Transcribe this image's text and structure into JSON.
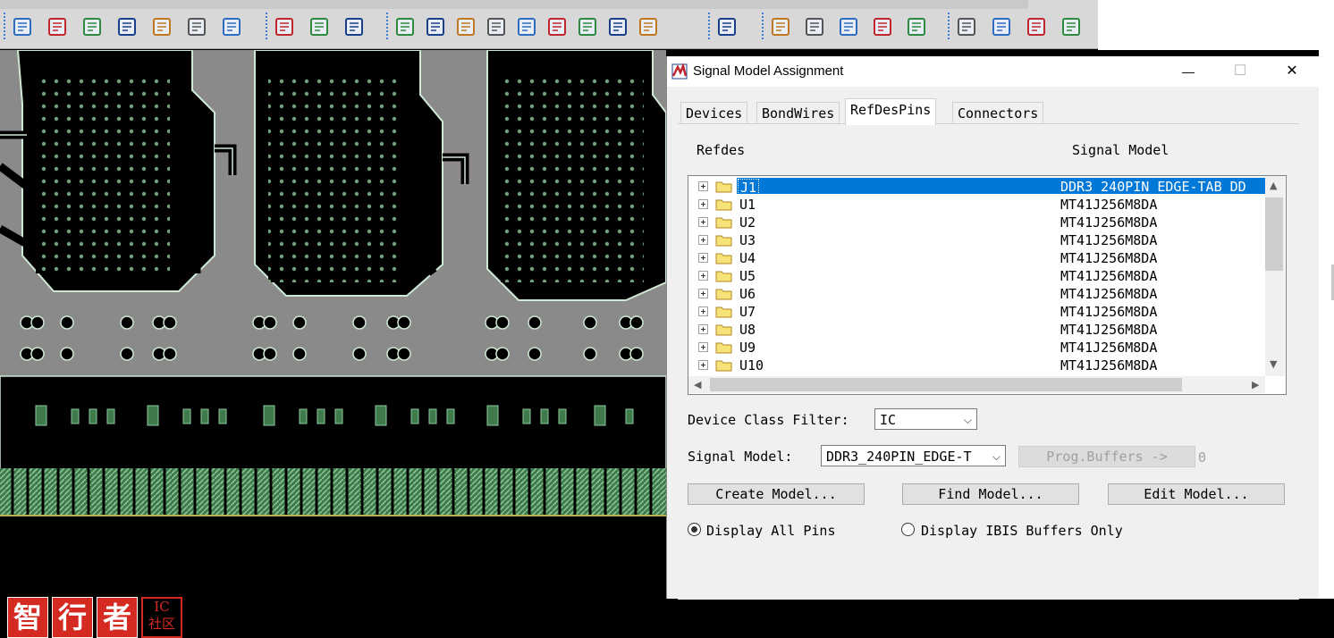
{
  "toolbar": {
    "groups": [
      [
        "select-pointer-icon",
        "rectangle-select-icon",
        "circle-select-icon",
        "square-outline-icon",
        "circle-outline-icon",
        "window-icon",
        "delete-icon"
      ],
      [
        "board-component-icon",
        "dimension-icon",
        "measure-icon"
      ],
      [
        "odb-export-icon",
        "library-icon",
        "probe-icon",
        "camera-icon",
        "refdes-icon",
        "book-icon",
        "grid-dots-icon",
        "tag-icon",
        "array-icon"
      ],
      [
        "waveform-icon"
      ],
      [
        "report-icon",
        "model-browser-icon",
        "component-icon",
        "check-icon",
        "wire-icon"
      ],
      [
        "copy-windows-icon",
        "signal-icon",
        "mail-icon",
        "help-icon"
      ]
    ]
  },
  "logo": {
    "chars": [
      "智",
      "行",
      "者"
    ],
    "seal_top": "IC",
    "seal_bottom": "社区"
  },
  "dialog": {
    "title": "Signal Model Assignment",
    "window_buttons": {
      "minimize": "—",
      "maximize": "☐",
      "close": "✕"
    },
    "tabs": [
      {
        "label": "Devices",
        "active": false
      },
      {
        "label": "BondWires",
        "active": false
      },
      {
        "label": "RefDesPins",
        "active": true
      },
      {
        "label": "Connectors",
        "active": false
      }
    ],
    "columns": {
      "refdes": "Refdes",
      "model": "Signal Model"
    },
    "rows": [
      {
        "refdes": "J1",
        "model": "DDR3_240PIN_EDGE-TAB_DD",
        "selected": true
      },
      {
        "refdes": "U1",
        "model": "MT41J256M8DA",
        "selected": false
      },
      {
        "refdes": "U2",
        "model": "MT41J256M8DA",
        "selected": false
      },
      {
        "refdes": "U3",
        "model": "MT41J256M8DA",
        "selected": false
      },
      {
        "refdes": "U4",
        "model": "MT41J256M8DA",
        "selected": false
      },
      {
        "refdes": "U5",
        "model": "MT41J256M8DA",
        "selected": false
      },
      {
        "refdes": "U6",
        "model": "MT41J256M8DA",
        "selected": false
      },
      {
        "refdes": "U7",
        "model": "MT41J256M8DA",
        "selected": false
      },
      {
        "refdes": "U8",
        "model": "MT41J256M8DA",
        "selected": false
      },
      {
        "refdes": "U9",
        "model": "MT41J256M8DA",
        "selected": false
      },
      {
        "refdes": "U10",
        "model": "MT41J256M8DA",
        "selected": false
      }
    ],
    "device_class_filter": {
      "label": "Device Class Filter:",
      "value": "IC"
    },
    "signal_model": {
      "label": "Signal Model:",
      "value": "DDR3_240PIN_EDGE-T"
    },
    "prog_buffers": {
      "label": "Prog.Buffers ->",
      "count": "0"
    },
    "buttons": {
      "create": "Create Model...",
      "find": "Find Model...",
      "edit": "Edit Model..."
    },
    "radios": {
      "all_pins": {
        "label": "Display All Pins",
        "checked": true
      },
      "ibis_only": {
        "label": "Display IBIS Buffers Only",
        "checked": false
      }
    }
  }
}
